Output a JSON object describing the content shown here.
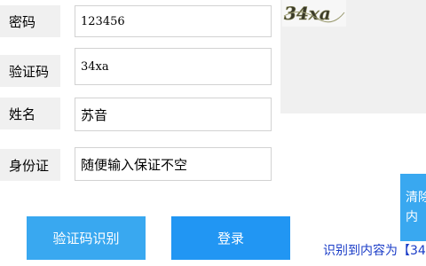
{
  "form": {
    "password": {
      "label": "密码",
      "value": "123456"
    },
    "captcha": {
      "label": "验证码",
      "value": "34xa"
    },
    "name": {
      "label": "姓名",
      "value": "苏音"
    },
    "id_card": {
      "label": "身份证",
      "value": "随便输入保证不空"
    }
  },
  "captcha_image": {
    "text": "34xa"
  },
  "buttons": {
    "recognize": "验证码识别",
    "login": "登录",
    "clear_line1": "清除",
    "clear_line2": "内"
  },
  "result": {
    "text": "识别到内容为【34"
  }
}
